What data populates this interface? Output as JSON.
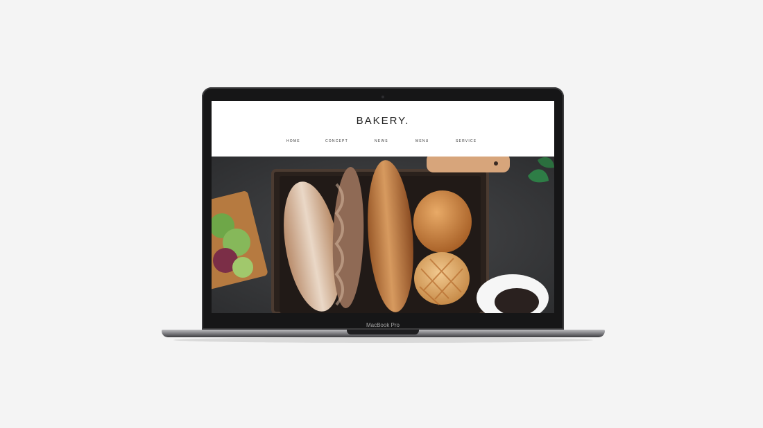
{
  "site": {
    "logo": "BAKERY.",
    "nav": [
      {
        "label": "HOME"
      },
      {
        "label": "CONCEPT"
      },
      {
        "label": "NEWS"
      },
      {
        "label": "MENU"
      },
      {
        "label": "SERVICE"
      }
    ]
  },
  "laptop": {
    "label": "MacBook Pro"
  },
  "colors": {
    "page_background": "#f4f4f4",
    "laptop_frame": "#161617",
    "hero_board": "#3a3b3d",
    "text_dark": "#222222"
  }
}
